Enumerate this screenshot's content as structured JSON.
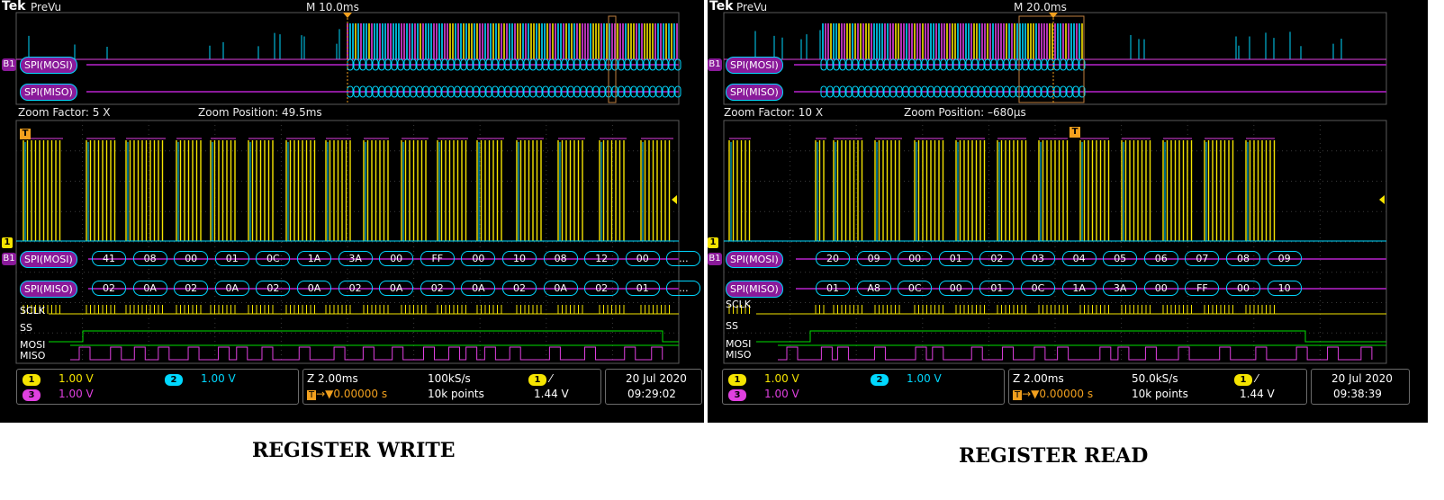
{
  "write": {
    "brand": "Tek",
    "mode": "PreVu",
    "timebase": "M 10.0ms",
    "bus_mosi": "SPI(MOSI)",
    "bus_miso": "SPI(MISO)",
    "zoom_factor": "Zoom Factor: 5 X",
    "zoom_position": "Zoom Position: 49.5ms",
    "mosi_bytes": [
      "41",
      "08",
      "00",
      "01",
      "0C",
      "1A",
      "3A",
      "00",
      "FF",
      "00",
      "10",
      "08",
      "12",
      "00",
      "..."
    ],
    "miso_bytes": [
      "02",
      "0A",
      "02",
      "0A",
      "02",
      "0A",
      "02",
      "0A",
      "02",
      "0A",
      "02",
      "0A",
      "02",
      "01",
      "..."
    ],
    "labels": {
      "sclk": "SCLK",
      "ss": "SS",
      "mosi": "MOSI",
      "miso": "MISO"
    },
    "ch1": "1.00 V",
    "ch2": "1.00 V",
    "ch3": "1.00 V",
    "zoom_time": "Z 2.00ms",
    "trig_pos": "0.00000 s",
    "sample_rate": "100kS/s",
    "record": "10k points",
    "trig_level": "1.44 V",
    "date": "20 Jul  2020",
    "time": "09:29:02"
  },
  "read": {
    "brand": "Tek",
    "mode": "PreVu",
    "timebase": "M 20.0ms",
    "bus_mosi": "SPI(MOSI)",
    "bus_miso": "SPI(MISO)",
    "zoom_factor": "Zoom Factor: 10 X",
    "zoom_position": "Zoom Position: –680µs",
    "mosi_bytes": [
      "20",
      "09",
      "00",
      "01",
      "02",
      "03",
      "04",
      "05",
      "06",
      "07",
      "08",
      "09"
    ],
    "miso_bytes": [
      "01",
      "A8",
      "0C",
      "00",
      "01",
      "0C",
      "1A",
      "3A",
      "00",
      "FF",
      "00",
      "10"
    ],
    "labels": {
      "sclk": "SCLK",
      "ss": "SS",
      "mosi": "MOSI",
      "miso": "MISO"
    },
    "ch1": "1.00 V",
    "ch2": "1.00 V",
    "ch3": "1.00 V",
    "zoom_time": "Z 2.00ms",
    "trig_pos": "0.00000 s",
    "sample_rate": "50.0kS/s",
    "record": "10k points",
    "trig_level": "1.44 V",
    "date": "20 Jul  2020",
    "time": "09:38:39"
  },
  "captions": {
    "left": "REGISTER WRITE",
    "right": "REGISTER READ"
  },
  "marks": {
    "ch1": "1",
    "ch2": "2",
    "ch3": "3",
    "bus": "B1",
    "trigger": "T"
  },
  "colors": {
    "ch1": "#f5e400",
    "ch2": "#00d8ff",
    "ch3": "#e040e0",
    "ss": "#00e000",
    "bus": "#8a1a9a",
    "trigger": "#f2a01e"
  }
}
